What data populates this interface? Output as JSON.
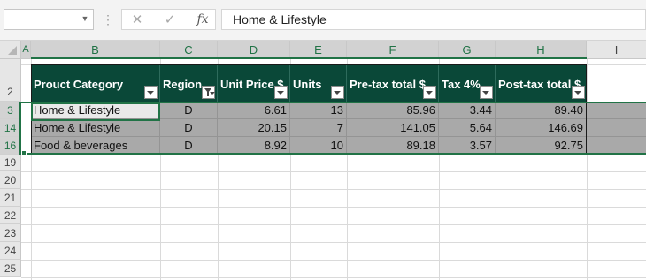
{
  "formula_bar": {
    "name_box_value": "",
    "dots": "⋮",
    "cancel_glyph": "✕",
    "enter_glyph": "✓",
    "fx_label": "fx",
    "content": "Home & Lifestyle"
  },
  "columns": [
    "A",
    "B",
    "C",
    "D",
    "E",
    "F",
    "G",
    "H",
    "I"
  ],
  "rows": {
    "header_row": "2",
    "data_rows": [
      "3",
      "14",
      "16"
    ],
    "empty_rows": [
      "19",
      "20",
      "21",
      "22",
      "23",
      "24",
      "25"
    ]
  },
  "table": {
    "headers": [
      "Prouct Category",
      "Region",
      "Unit Price $",
      "Units",
      "Pre-tax total $",
      "Tax 4%",
      "Post-tax total $"
    ],
    "filtered_column_index": 1,
    "rows": [
      [
        "Home & Lifestyle",
        "D",
        "6.61",
        "13",
        "85.96",
        "3.44",
        "89.40"
      ],
      [
        "Home & Lifestyle",
        "D",
        "20.15",
        "7",
        "141.05",
        "5.64",
        "146.69"
      ],
      [
        "Food & beverages",
        "D",
        "8.92",
        "10",
        "89.18",
        "3.57",
        "92.75"
      ]
    ]
  },
  "colors": {
    "accent": "#217346",
    "table_header": "#0a4838",
    "selected_rows": "#a9a9a9",
    "active_cell": "#e9e9e9"
  }
}
